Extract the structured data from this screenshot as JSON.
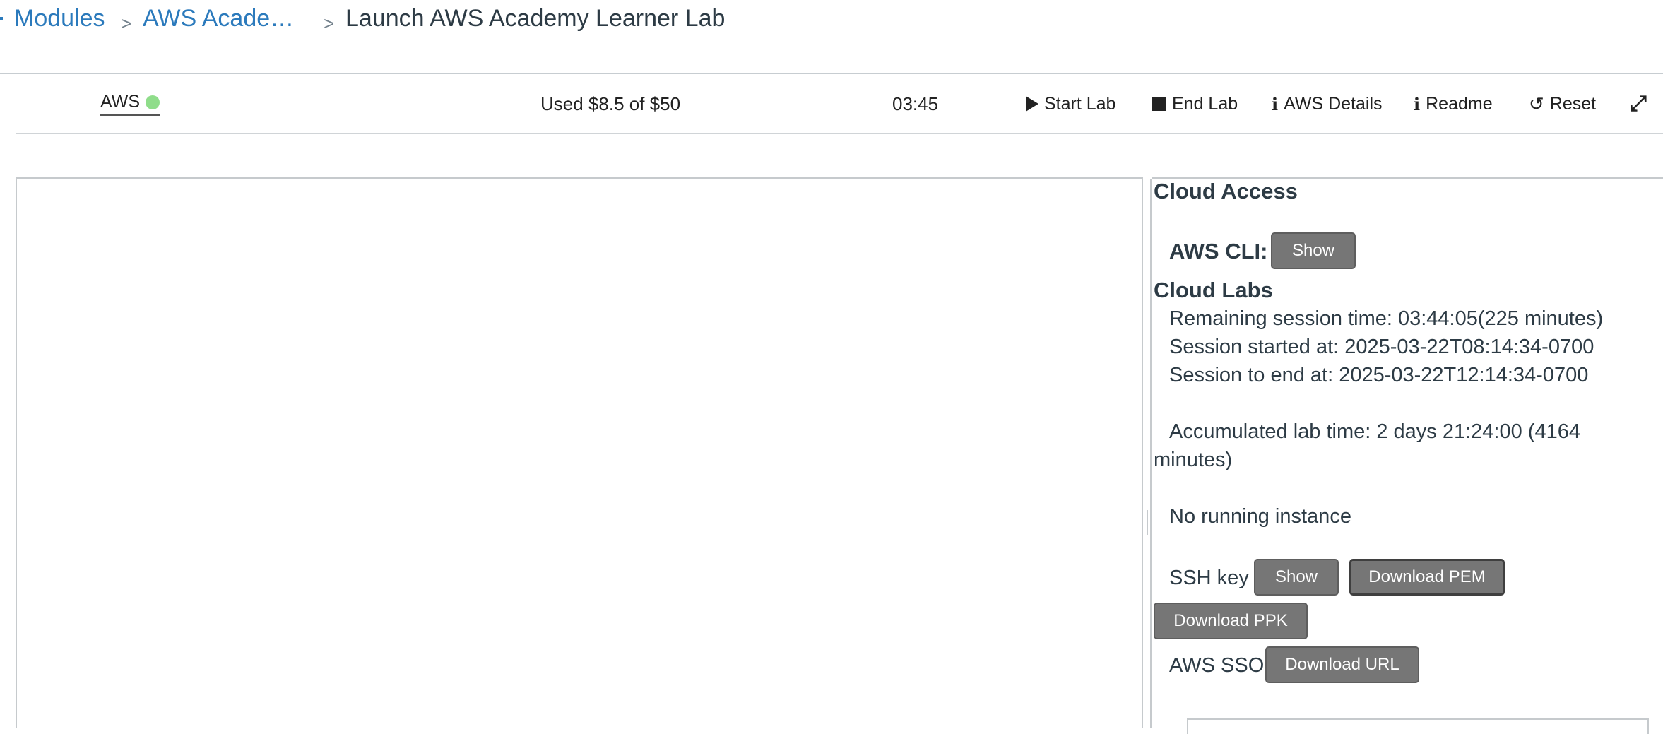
{
  "breadcrumb": {
    "items": [
      "Modules",
      "AWS Acade…"
    ],
    "current": "Launch AWS Academy Learner Lab",
    "separator": ">"
  },
  "toolbar": {
    "aws_label": "AWS",
    "status_color": "#8fdd8a",
    "budget": "Used $8.5 of $50",
    "timer": "03:45",
    "start_lab": "Start Lab",
    "end_lab": "End Lab",
    "aws_details": "AWS Details",
    "readme": "Readme",
    "reset": "Reset",
    "icons": {
      "start": "play-icon",
      "end": "stop-icon",
      "details": "info-icon",
      "readme": "info-icon",
      "reset": "reset-icon",
      "expand": "expand-icon"
    }
  },
  "panel": {
    "cloud_access_heading": "Cloud Access",
    "aws_cli_label": "AWS CLI:",
    "aws_cli_button": "Show",
    "cloud_labs_heading": "Cloud Labs",
    "remaining": "Remaining session time: 03:44:05(225 minutes)",
    "started": "Session started at: 2025-03-22T08:14:34-0700",
    "to_end": "Session to end  at: 2025-03-22T12:14:34-0700",
    "accumulated_line1": "Accumulated lab time: 2 days 21:24:00 (4164",
    "accumulated_line2": "minutes)",
    "no_instance": "No running instance",
    "ssh_key_label": "SSH key",
    "ssh_show": "Show",
    "download_pem": "Download PEM",
    "download_ppk": "Download PPK",
    "aws_sso_label": "AWS SSO",
    "download_url": "Download URL"
  }
}
